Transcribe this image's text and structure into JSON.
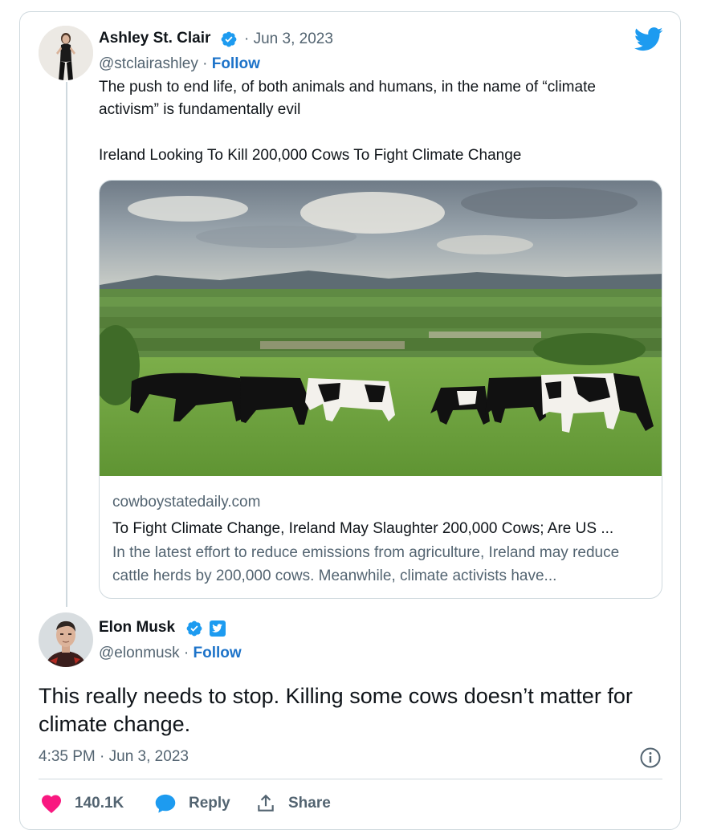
{
  "parent_tweet": {
    "author_name": "Ashley St. Clair",
    "date": "· Jun 3, 2023",
    "handle": "@stclairashley",
    "separator": " · ",
    "follow_label": "Follow",
    "text_line1": "The push to end life, of both animals and humans, in the name of “climate",
    "text_line2": "activism” is fundamentally evil",
    "text_line3": "Ireland Looking To Kill 200,000 Cows To Fight Climate Change",
    "link_card": {
      "domain": "cowboystatedaily.com",
      "title": "To Fight Climate Change, Ireland May Slaughter 200,000 Cows; Are US ...",
      "description": "In the latest effort to reduce emissions from agriculture, Ireland may reduce cattle herds by 200,000 cows. Meanwhile, climate activists have..."
    }
  },
  "main_tweet": {
    "author_name": "Elon Musk",
    "handle": "@elonmusk",
    "separator": " · ",
    "follow_label": "Follow",
    "text": "This really needs to stop. Killing some cows doesn’t matter for climate change.",
    "timestamp": "4:35 PM · Jun 3, 2023"
  },
  "actions": {
    "like_count": "140.1K",
    "reply_label": "Reply",
    "share_label": "Share"
  },
  "colors": {
    "twitter_blue": "#1d9bf0",
    "like_red": "#f91880",
    "follow_link": "#1d73c9"
  },
  "icons": [
    "twitter-bird-icon",
    "verified-badge-icon",
    "twitter-affiliate-icon",
    "info-icon",
    "heart-icon",
    "reply-bubble-icon",
    "share-icon"
  ]
}
